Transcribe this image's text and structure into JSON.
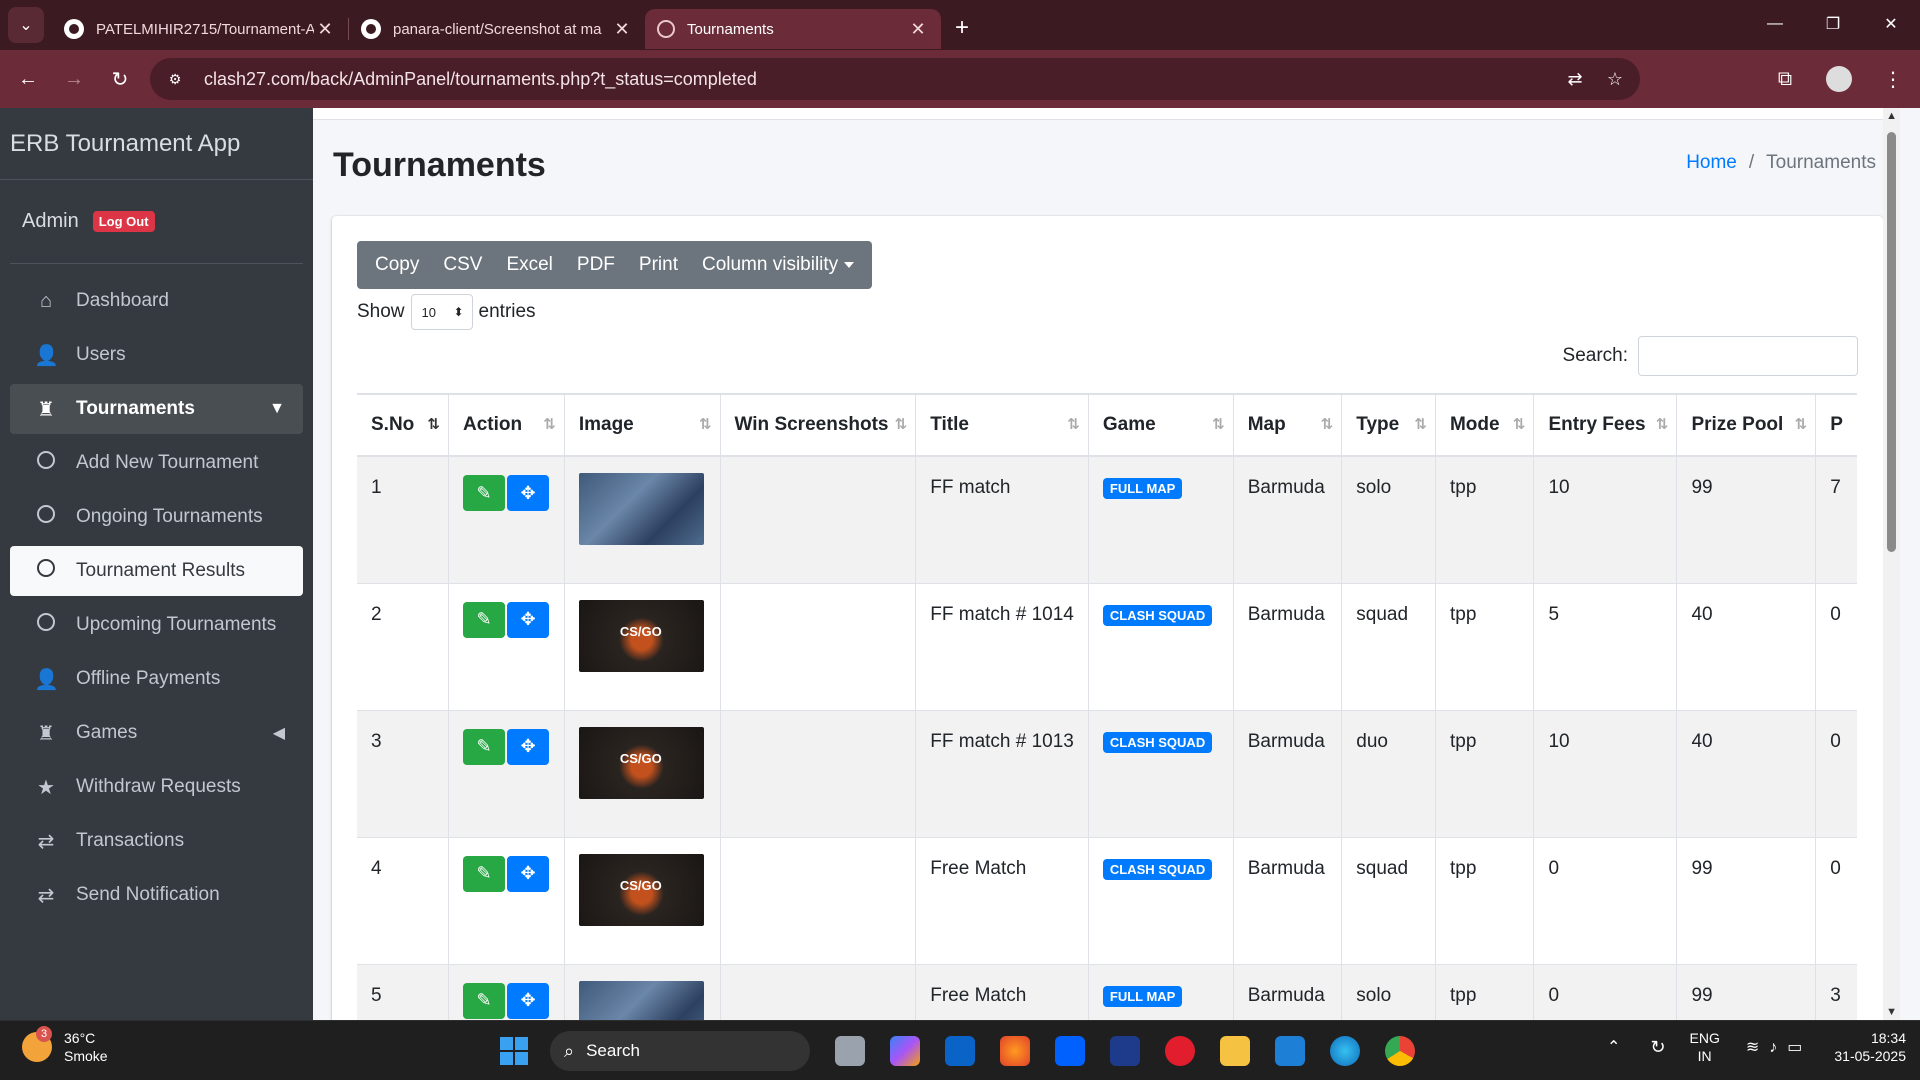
{
  "browser": {
    "tabs": [
      {
        "title": "PATELMIHIR2715/Tournament-A",
        "icon": "github-icon"
      },
      {
        "title": "panara-client/Screenshot at ma",
        "icon": "github-icon"
      },
      {
        "title": "Tournaments",
        "icon": "globe-icon",
        "active": true
      }
    ],
    "url": "clash27.com/back/AdminPanel/tournaments.php?t_status=completed"
  },
  "sidebar": {
    "brand": "ERB Tournament App",
    "user_name": "Admin",
    "logout_label": "Log Out",
    "items": [
      {
        "label": "Dashboard",
        "icon": "home-icon"
      },
      {
        "label": "Users",
        "icon": "user-icon"
      },
      {
        "label": "Tournaments",
        "icon": "chess-icon"
      },
      {
        "label": "Add New Tournament",
        "icon": "circle-icon"
      },
      {
        "label": "Ongoing Tournaments",
        "icon": "circle-icon"
      },
      {
        "label": "Tournament Results",
        "icon": "circle-icon"
      },
      {
        "label": "Upcoming Tournaments",
        "icon": "circle-icon"
      },
      {
        "label": "Offline Payments",
        "icon": "user-icon"
      },
      {
        "label": "Games",
        "icon": "chess-icon"
      },
      {
        "label": "Withdraw Requests",
        "icon": "star-icon"
      },
      {
        "label": "Transactions",
        "icon": "exchange-icon"
      },
      {
        "label": "Send Notification",
        "icon": "exchange-icon"
      }
    ]
  },
  "page": {
    "title": "Tournaments",
    "breadcrumb_home": "Home",
    "breadcrumb_sep": "/",
    "breadcrumb_current": "Tournaments"
  },
  "toolbar": {
    "copy": "Copy",
    "csv": "CSV",
    "excel": "Excel",
    "pdf": "PDF",
    "print": "Print",
    "column_visibility": "Column visibility"
  },
  "entries": {
    "show": "Show",
    "value": "10",
    "suffix": "entries"
  },
  "search": {
    "label": "Search:"
  },
  "table": {
    "headers": [
      "S.No",
      "Action",
      "Image",
      "Win Screenshots",
      "Title",
      "Game",
      "Map",
      "Type",
      "Mode",
      "Entry Fees",
      "Prize Pool",
      "P"
    ],
    "rows": [
      {
        "sno": "1",
        "image": "ff",
        "title": "FF match",
        "game": "FULL MAP",
        "map": "Barmuda",
        "type": "solo",
        "mode": "tpp",
        "fees": "10",
        "prize": "99",
        "p": "7"
      },
      {
        "sno": "2",
        "image": "cs",
        "title": "FF match # 1014",
        "game": "CLASH SQUAD",
        "map": "Barmuda",
        "type": "squad",
        "mode": "tpp",
        "fees": "5",
        "prize": "40",
        "p": "0"
      },
      {
        "sno": "3",
        "image": "cs",
        "title": "FF match # 1013",
        "game": "CLASH SQUAD",
        "map": "Barmuda",
        "type": "duo",
        "mode": "tpp",
        "fees": "10",
        "prize": "40",
        "p": "0"
      },
      {
        "sno": "4",
        "image": "cs",
        "title": "Free Match",
        "game": "CLASH SQUAD",
        "map": "Barmuda",
        "type": "squad",
        "mode": "tpp",
        "fees": "0",
        "prize": "99",
        "p": "0"
      },
      {
        "sno": "5",
        "image": "ff",
        "title": "Free Match",
        "game": "FULL MAP",
        "map": "Barmuda",
        "type": "solo",
        "mode": "tpp",
        "fees": "0",
        "prize": "99",
        "p": "3"
      }
    ]
  },
  "taskbar": {
    "weather_temp": "36°C",
    "weather_desc": "Smoke",
    "weather_badge": "3",
    "search_label": "Search",
    "lang_top": "ENG",
    "lang_bottom": "IN",
    "time": "18:34",
    "date": "31-05-2025"
  },
  "colors": {
    "sidebar_bg": "#343a40",
    "accent": "#007bff",
    "edit": "#28a745",
    "browser": "#6b2b38"
  }
}
